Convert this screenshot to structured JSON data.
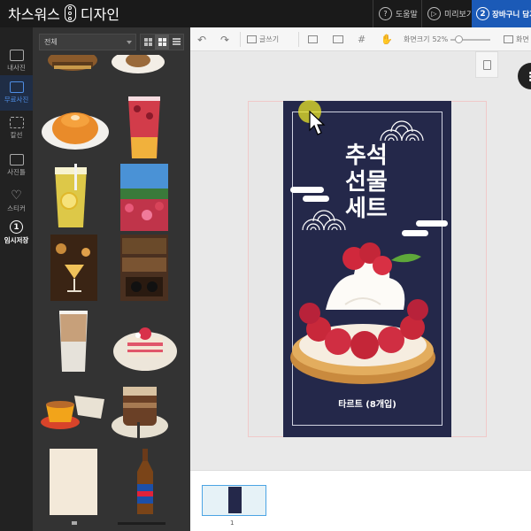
{
  "header": {
    "logo_left": "차스워스",
    "logo_right": "디자인",
    "help": "도움말",
    "preview": "미리보기",
    "cart_step": "2",
    "cart": "장바구니 담기"
  },
  "rail": [
    {
      "label": "내사진",
      "icon": "camera-icon"
    },
    {
      "label": "무료사진",
      "icon": "photos-icon",
      "active": true
    },
    {
      "label": "칼선",
      "icon": "cutline-icon"
    },
    {
      "label": "사진틀",
      "icon": "frame-icon"
    },
    {
      "label": "스티커",
      "icon": "heart-icon"
    },
    {
      "label": "임시저장",
      "badge": "1"
    }
  ],
  "panel": {
    "filter_value": "전체"
  },
  "toolbar": {
    "text_tool": "글쓰기",
    "zoom_label": "화면크기",
    "zoom_value": "52%",
    "fit_label": "화면"
  },
  "card": {
    "title_lines": [
      "추석",
      "선물",
      "세트"
    ],
    "caption": "타르트 (8개입)"
  },
  "pages": {
    "current_page": "1"
  },
  "colors": {
    "accent": "#1b5ab7",
    "card_navy": "#24284a",
    "active_rail": "#4e8de4",
    "cursor_highlight": "#e8e428"
  }
}
